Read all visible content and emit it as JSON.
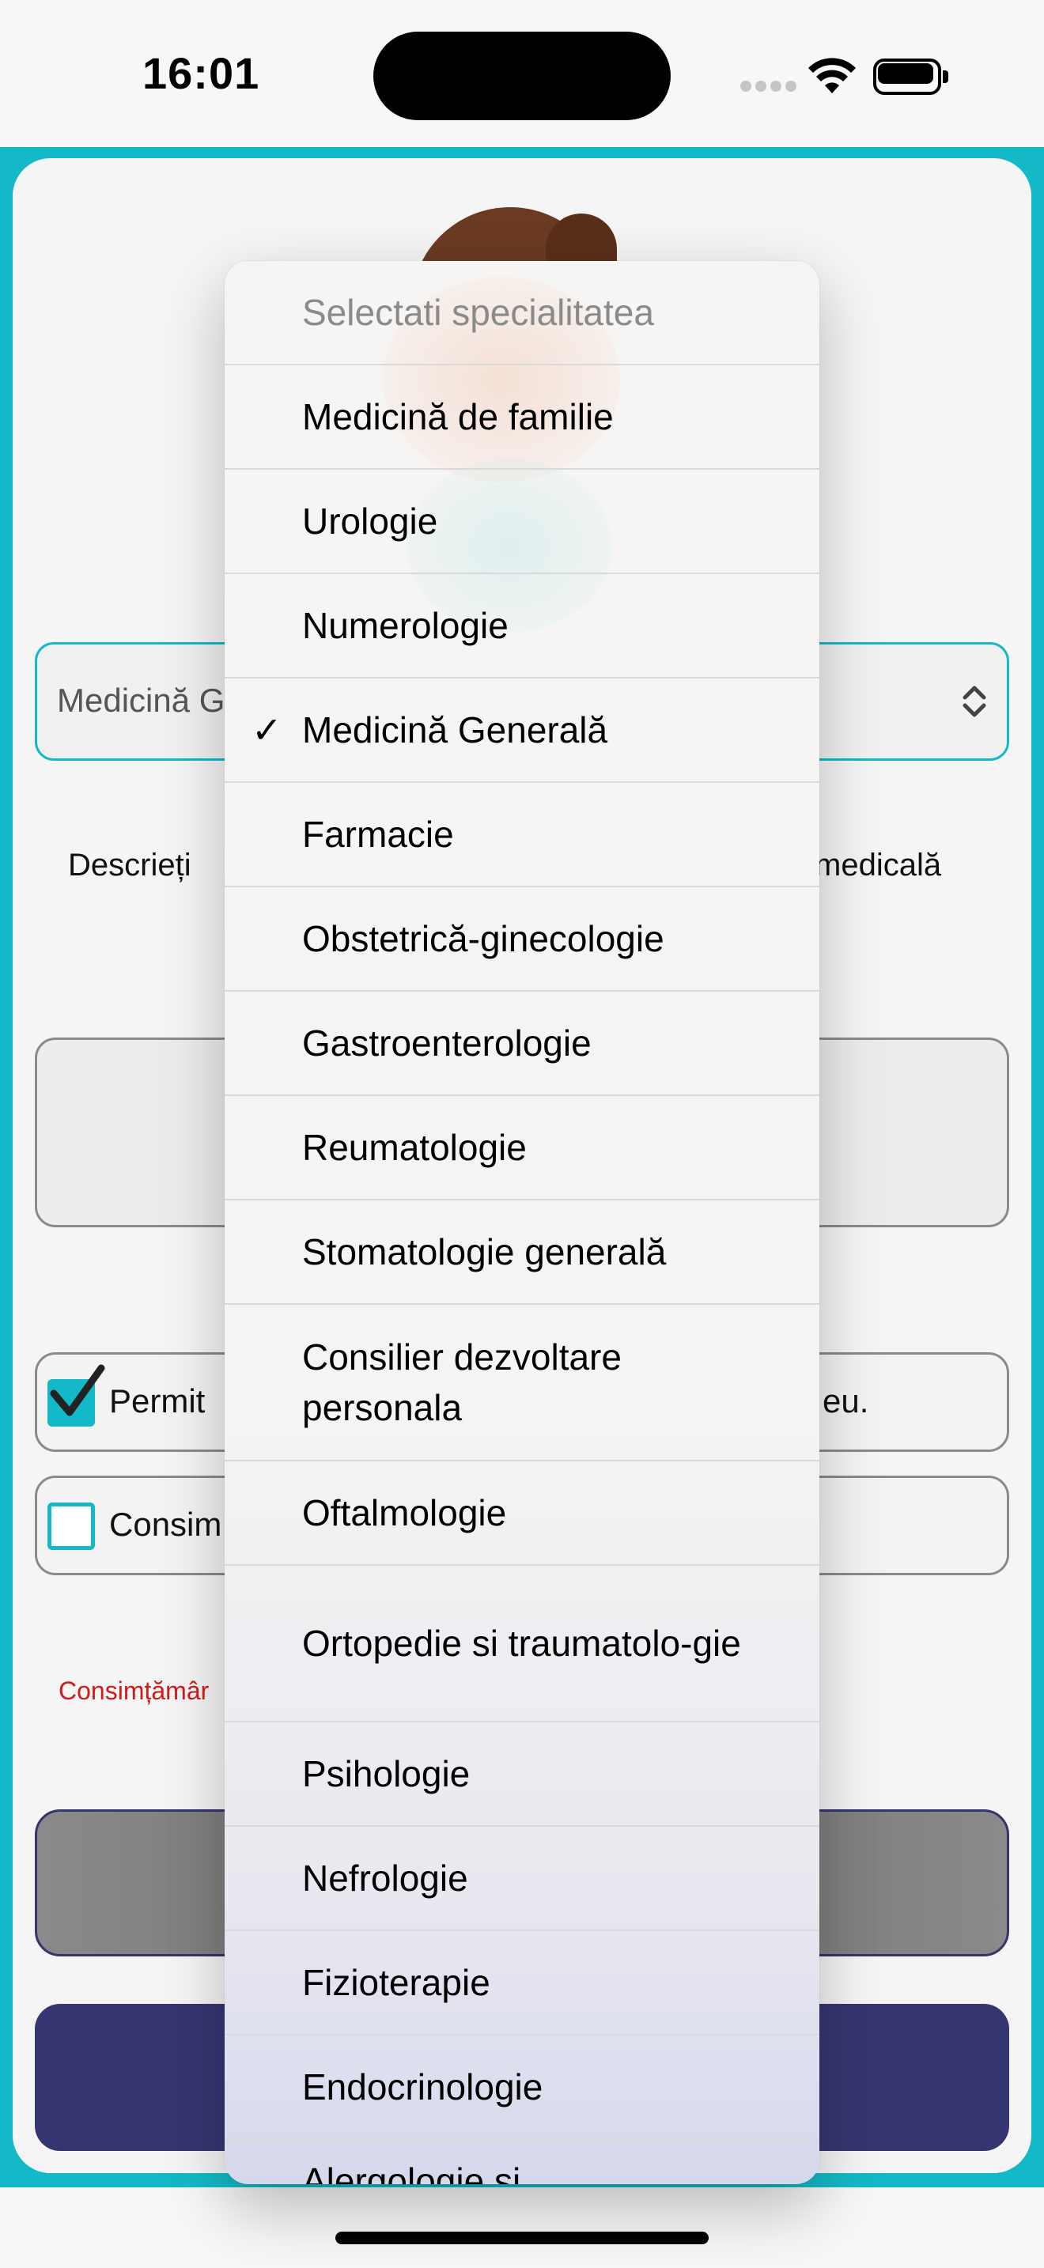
{
  "status_bar": {
    "time": "16:01"
  },
  "form": {
    "specialty_select_value": "Medicină G",
    "describe_text_left": "Descrieți",
    "describe_text_right": "medicală",
    "checkbox1": {
      "checked": true,
      "label_left": "Permit",
      "label_right": "eu."
    },
    "checkbox2": {
      "checked": false,
      "label_left": "Consim"
    },
    "consent_error": "Consimțămâr"
  },
  "dropdown": {
    "placeholder": "Selectati specialitatea",
    "selected_index": 3,
    "check_glyph": "✓",
    "items": [
      "Medicină de familie",
      "Urologie",
      "Numerologie",
      "Medicină Generală",
      "Farmacie",
      "Obstetrică-ginecologie",
      "Gastroenterologie",
      "Reumatologie",
      "Stomatologie generală",
      "Consilier dezvoltare personala",
      "Oftalmologie",
      "Ortopedie si traumatolo-gie",
      "Psihologie",
      "Nefrologie",
      "Fizioterapie",
      "Endocrinologie",
      "Alergologie si"
    ]
  },
  "colors": {
    "accent_teal": "#13b9c6",
    "button_navy": "#353671",
    "error_red": "#d11a1a"
  }
}
